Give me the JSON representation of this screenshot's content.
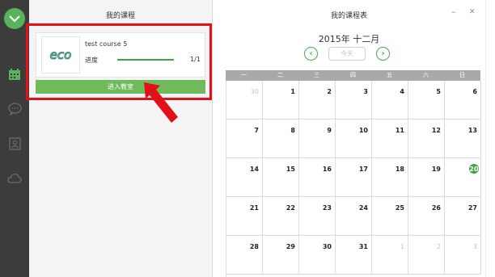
{
  "course_panel": {
    "title": "我的课程",
    "course": {
      "name": "test course 5",
      "logo_text": "eco",
      "progress_label": "进度",
      "progress_count": "1/1",
      "progress_fraction": 1.0
    },
    "enter_button": "进入教室"
  },
  "calendar": {
    "title": "我的课程表",
    "month_label": "2015年 十二月",
    "prev_symbol": "‹",
    "next_symbol": "›",
    "today_button": "今天",
    "minimize_symbol": "–",
    "close_symbol": "✕",
    "weekdays": [
      "一",
      "二",
      "三",
      "四",
      "五",
      "六",
      "日"
    ],
    "days": [
      {
        "n": "30",
        "muted": true
      },
      {
        "n": "1"
      },
      {
        "n": "2"
      },
      {
        "n": "3"
      },
      {
        "n": "4"
      },
      {
        "n": "5"
      },
      {
        "n": "6"
      },
      {
        "n": "7"
      },
      {
        "n": "8"
      },
      {
        "n": "9"
      },
      {
        "n": "10"
      },
      {
        "n": "11"
      },
      {
        "n": "12"
      },
      {
        "n": "13"
      },
      {
        "n": "14"
      },
      {
        "n": "15"
      },
      {
        "n": "16"
      },
      {
        "n": "17"
      },
      {
        "n": "18"
      },
      {
        "n": "19"
      },
      {
        "n": "20",
        "today": true
      },
      {
        "n": "21"
      },
      {
        "n": "22"
      },
      {
        "n": "23"
      },
      {
        "n": "24"
      },
      {
        "n": "25"
      },
      {
        "n": "26"
      },
      {
        "n": "27"
      },
      {
        "n": "28"
      },
      {
        "n": "29"
      },
      {
        "n": "30"
      },
      {
        "n": "31"
      },
      {
        "n": "1",
        "muted": true
      },
      {
        "n": "2",
        "muted": true
      },
      {
        "n": "3",
        "muted": true
      }
    ]
  },
  "rail_icons": [
    "logo-icon",
    "calendar-icon",
    "chat-icon",
    "contact-icon",
    "cloud-icon"
  ],
  "colors": {
    "accent_green": "#59b35a",
    "button_green": "#6fba5b",
    "highlight_red": "#e3101a",
    "rail_dark": "#3c3c3c",
    "header_gray": "#a9a9a9"
  }
}
